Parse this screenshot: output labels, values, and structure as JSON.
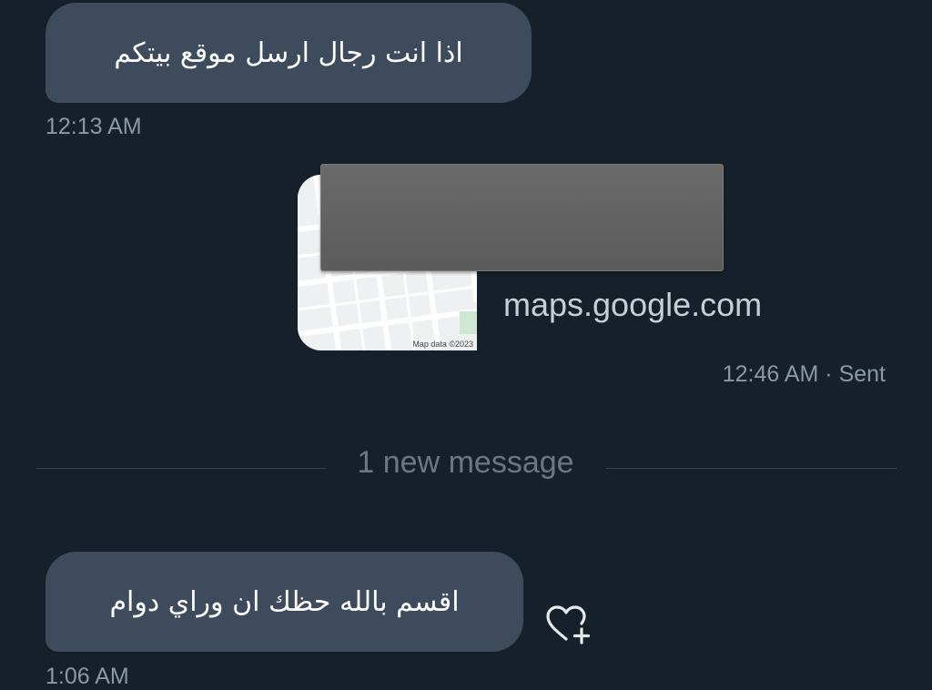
{
  "messages": [
    {
      "text": "اذا انت رجال ارسل موقع بيتكم",
      "time": "12:13 AM"
    },
    {
      "text": "اقسم بالله حظك ان وراي دوام",
      "time": "1:06 AM"
    }
  ],
  "link_card": {
    "domain": "maps.google.com",
    "map_credit": "Map data ©2023",
    "time_sent": "12:46 AM · Sent"
  },
  "divider": {
    "label": "1 new message"
  },
  "icons": {
    "reaction": "heart-plus-icon"
  },
  "colors": {
    "background": "#15202b",
    "bubble": "#3e4b5c",
    "muted": "#8b98a5"
  }
}
